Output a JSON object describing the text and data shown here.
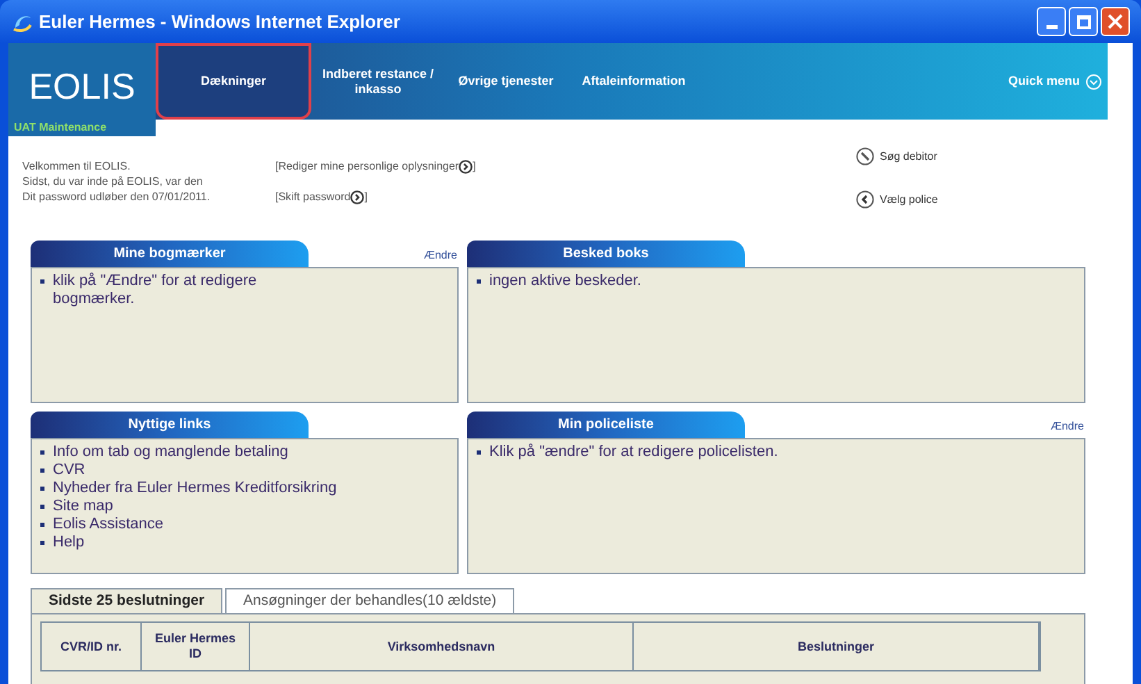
{
  "window": {
    "title": "Euler Hermes - Windows Internet Explorer"
  },
  "brand": {
    "logo": "EOLIS",
    "subtitle": "UAT Maintenance"
  },
  "nav": [
    {
      "label": "Dækninger",
      "selected": true
    },
    {
      "label": "Indberet restance / inkasso",
      "selected": false
    },
    {
      "label": "Øvrige tjenester",
      "selected": false
    },
    {
      "label": "Aftaleinformation",
      "selected": false
    }
  ],
  "quick_menu": "Quick menu",
  "welcome": [
    {
      "text": "Velkommen til EOLIS.",
      "link": "[Rediger mine personlige oplysninger",
      "link_end": "]"
    },
    {
      "text": "Sidst, du var inde på EOLIS, var den"
    },
    {
      "text": "Dit password udløber den 07/01/2011.",
      "link": "[Skift password",
      "link_end": "]"
    }
  ],
  "side_links": [
    {
      "kind": "search",
      "label": "Søg debitor"
    },
    {
      "kind": "back",
      "label": "Vælg police"
    }
  ],
  "panels": [
    {
      "title": "Mine bogmærker",
      "edit": "Ændre",
      "items": [
        "klik på \"Ændre\" for at redigere bogmærker."
      ]
    },
    {
      "title": "Besked boks",
      "items": [
        "ingen aktive beskeder."
      ]
    },
    {
      "title": "Nyttige links",
      "items": [
        "Info om tab og manglende betaling",
        "CVR",
        "Nyheder fra Euler Hermes Kreditforsikring",
        "Site map",
        "Eolis Assistance",
        "Help"
      ]
    },
    {
      "title": "Min policeliste",
      "edit": "Ændre",
      "items": [
        "Klik på \"ændre\" for at redigere policelisten."
      ]
    }
  ],
  "tabs": [
    {
      "label": "Sidste 25 beslutninger",
      "selected": true
    },
    {
      "label": "Ansøgninger der behandles(10 ældste)",
      "selected": false
    }
  ],
  "table": {
    "columns": [
      "CVR/ID nr.",
      "Euler Hermes ID",
      "Virksomhedsnavn",
      "Beslutninger"
    ]
  }
}
